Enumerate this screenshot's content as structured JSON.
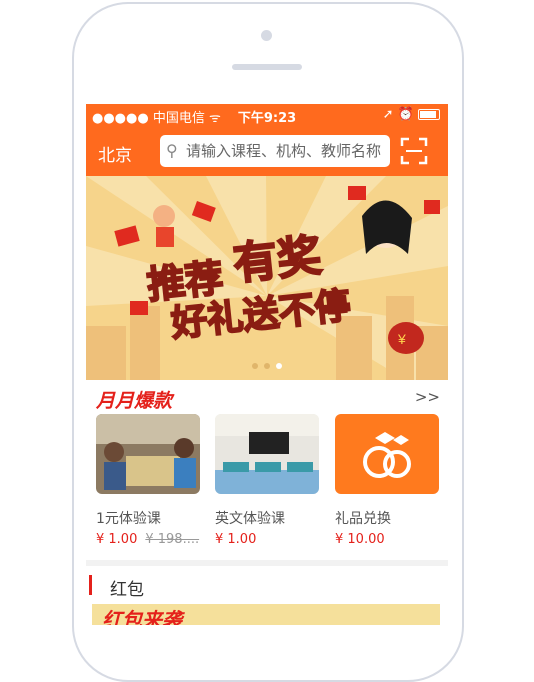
{
  "status_bar": {
    "signal": "●●●●● 中国电信 ᯤ",
    "time": "下午9:23",
    "icons": "➚ ⏰"
  },
  "header": {
    "city": "北京",
    "search_placeholder": "请输入课程、机构、教师名称"
  },
  "banner": {
    "line1_a": "推荐",
    "line1_b": "有奖",
    "line2": "好礼送不停",
    "coin_label": "¥"
  },
  "monthly_hot": {
    "title": "月月爆款",
    "more": ">>",
    "items": [
      {
        "name": "1元体验课",
        "price": "¥ 1.00",
        "original_price": "¥ 198...."
      },
      {
        "name": "英文体验课",
        "price": "¥ 1.00"
      },
      {
        "name": "礼品兑换",
        "price": "¥ 10.00"
      }
    ]
  },
  "red_packet": {
    "title": "红包",
    "banner_text": "红包来袭"
  },
  "colors": {
    "brand_orange": "#ff6a1e",
    "accent_red": "#e4211b"
  }
}
